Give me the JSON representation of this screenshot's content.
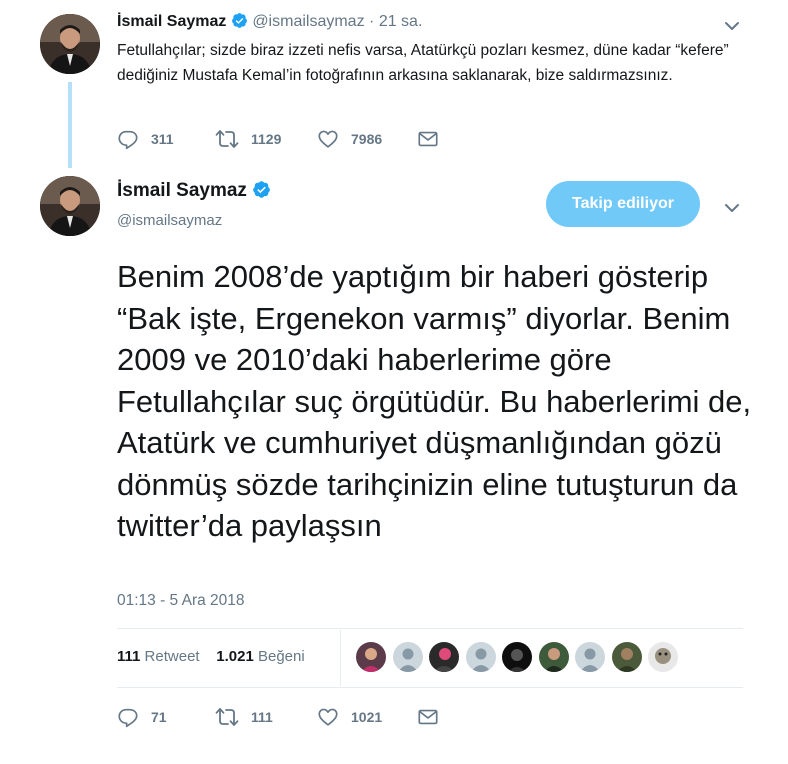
{
  "parent_tweet": {
    "author_name": "İsmail Saymaz",
    "handle": "@ismailsaymaz",
    "separator": "·",
    "time": "21 sa.",
    "text": "Fetullahçılar; sizde biraz izzeti nefis varsa, Atatürkçü pozları kesmez, düne kadar “kefere” dediğiniz Mustafa Kemal’in fotoğrafının arkasına saklanarak, bize saldırmazsınız.",
    "replies": "311",
    "retweets": "1129",
    "likes": "7986"
  },
  "main_tweet": {
    "author_name": "İsmail Saymaz",
    "handle": "@ismailsaymaz",
    "follow_label": "Takip ediliyor",
    "text": "Benim 2008’de yaptığım bir haberi gösterip “Bak işte, Ergenekon varmış” diyorlar. Benim 2009 ve 2010’daki haberlerime göre Fetullahçılar suç örgütüdür. Bu haberlerimi de, Atatürk ve cumhuriyet düşmanlığından gözü dönmüş sözde tarihçinizin eline tutuşturun da twitter’da paylaşsın",
    "timestamp": "01:13 - 5 Ara 2018",
    "retweet_count": "111",
    "retweet_label": "Retweet",
    "like_count": "1.021",
    "like_label": "Beğeni",
    "replies": "71",
    "retweets": "111",
    "likes": "1021"
  },
  "colors": {
    "accent": "#1da1f2",
    "follow_button": "#71c9f8",
    "muted_text": "#657786",
    "thread_line": "#b4e1f8",
    "divider": "#e6ecf0"
  },
  "icons": [
    "verified-badge-icon",
    "chevron-down-icon",
    "reply-icon",
    "retweet-icon",
    "like-icon",
    "direct-message-icon"
  ],
  "liker_avatar_count": 9
}
